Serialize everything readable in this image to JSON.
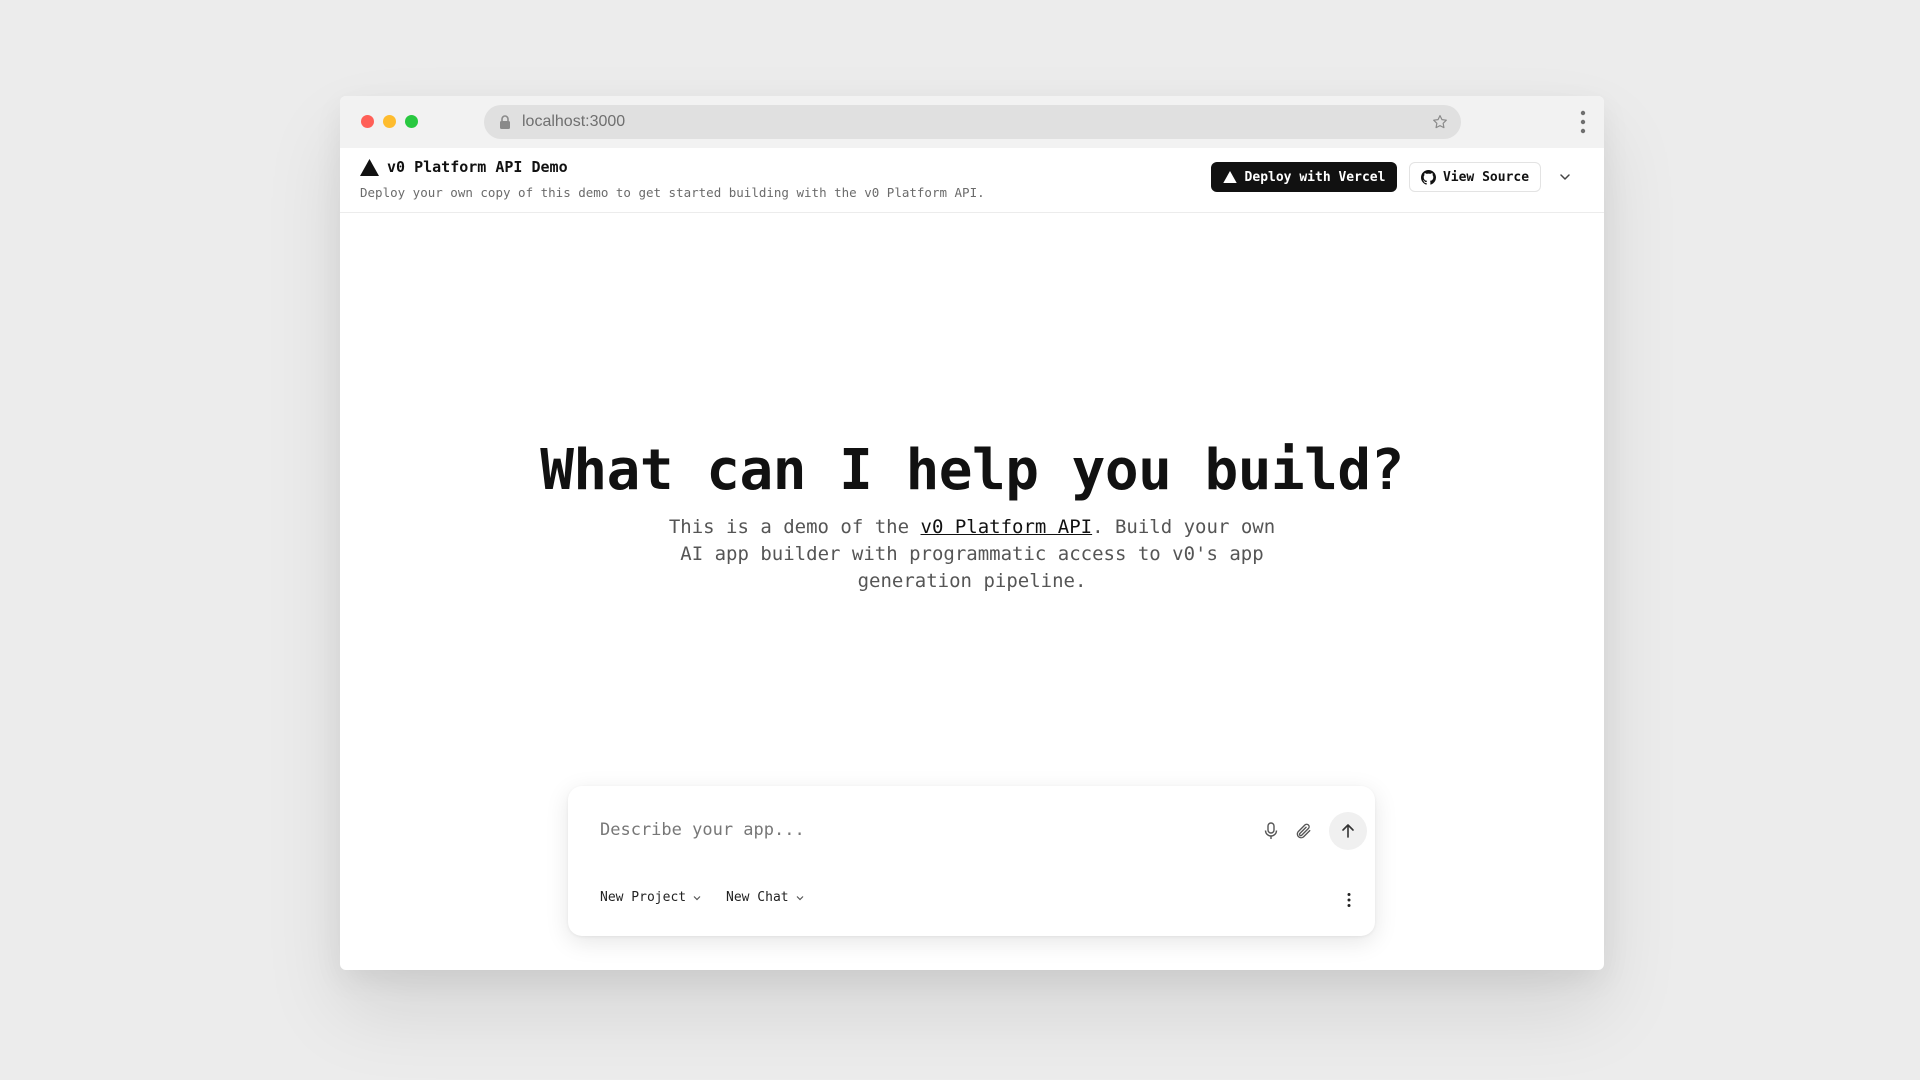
{
  "browser": {
    "url": "localhost:3000"
  },
  "header": {
    "title": "v0 Platform API Demo",
    "subtitle": "Deploy your own copy of this demo to get started building with the v0 Platform API.",
    "deploy_label": "Deploy with Vercel",
    "source_label": "View Source"
  },
  "hero": {
    "title": "What can I help you build?",
    "desc_before": "This is a demo of the ",
    "desc_link": "v0 Platform API",
    "desc_after": ". Build your own AI app builder with programmatic access to v0's app generation pipeline."
  },
  "composer": {
    "placeholder": "Describe your app...",
    "project_label": "New Project",
    "chat_label": "New Chat"
  },
  "colors": {
    "accent": "#111111",
    "background": "#ececec",
    "traffic_red": "#ff5f57",
    "traffic_yellow": "#febc2e",
    "traffic_green": "#28c840"
  },
  "icons": [
    "lock-icon",
    "star-icon",
    "more-vertical-icon",
    "vercel-triangle-icon",
    "github-icon",
    "chevron-down-icon",
    "microphone-icon",
    "paperclip-icon",
    "arrow-up-icon"
  ]
}
